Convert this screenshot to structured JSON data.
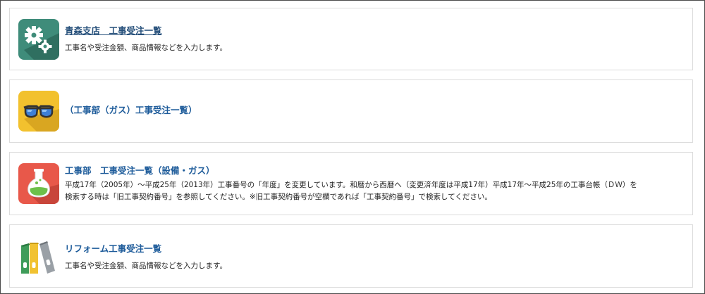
{
  "cards": [
    {
      "title": "青森支店　工事受注一覧",
      "description": "工事名や受注金額、商品情報などを入力します。",
      "icon": "gears-icon",
      "icon_color": "#3f8c7a"
    },
    {
      "title": "（工事部（ガス）工事受注一覧）",
      "icon": "glasses-icon",
      "icon_color": "#f2c12e"
    },
    {
      "title": "工事部　工事受注一覧（設備・ガス）",
      "description_lines": [
        "平成17年（2005年）～平成25年（2013年）工事番号の「年度」を変更しています。和暦から西暦へ（変更済年度は平成17年）平成17年～平成25年の工事台帳（ＤＷ）を",
        "検索する時は「旧工事契約番号」を参照してください。※旧工事契約番号が空欄であれば「工事契約番号」で検索してください。"
      ],
      "icon": "flask-icon",
      "icon_color": "#e8584a"
    },
    {
      "title": "リフォーム工事受注一覧",
      "description": "工事名や受注金額、商品情報などを入力します。",
      "icon": "binders-icon"
    }
  ]
}
